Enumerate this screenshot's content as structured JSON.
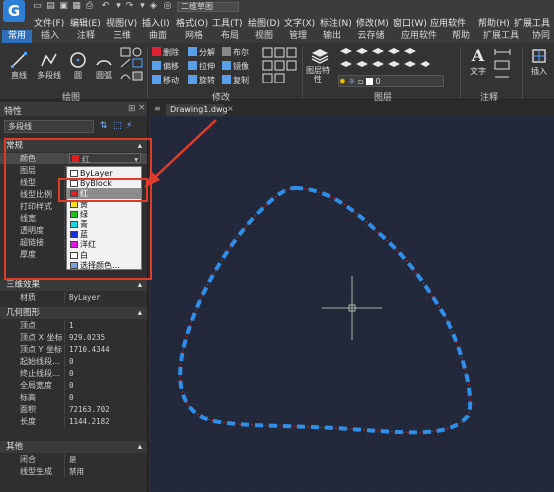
{
  "app": {
    "logo": "G",
    "document_title": "二维草图"
  },
  "menu": [
    "文件(F)",
    "编辑(E)",
    "视图(V)",
    "插入(I)",
    "格式(O)",
    "工具(T)",
    "绘图(D)",
    "文字(X)",
    "标注(N)",
    "修改(M)",
    "窗口(W)",
    "应用软件",
    "帮助(H)",
    "扩展工具"
  ],
  "ribbon_tabs": [
    "常用",
    "插入",
    "注释",
    "三维",
    "曲面",
    "网格",
    "布局",
    "视图",
    "管理",
    "输出",
    "云存储",
    "应用软件",
    "帮助",
    "扩展工具",
    "协同"
  ],
  "ribbon": {
    "draw_tools": [
      "直线",
      "多段线",
      "圆",
      "圆弧"
    ],
    "modify_tools": [
      "删除",
      "分解",
      "布尔",
      "偏移",
      "拉伸",
      "镜像",
      "移动",
      "旋转",
      "复制"
    ],
    "layer_tool": "图层特性",
    "layer_value": "0",
    "text_tool": "文字",
    "insert_tool": "插入",
    "group_draw": "绘图",
    "group_modify": "修改",
    "group_layer": "图层",
    "group_annot": "注释"
  },
  "properties": {
    "title": "特性",
    "object_type": "多段线",
    "general": {
      "section": "常规",
      "rows": [
        {
          "k": "颜色",
          "v": "红"
        },
        {
          "k": "图层",
          "v": ""
        },
        {
          "k": "线型",
          "v": ""
        },
        {
          "k": "线型比例",
          "v": ""
        },
        {
          "k": "打印样式",
          "v": ""
        },
        {
          "k": "线宽",
          "v": ""
        },
        {
          "k": "透明度",
          "v": ""
        },
        {
          "k": "超链接",
          "v": ""
        },
        {
          "k": "厚度",
          "v": ""
        }
      ]
    },
    "three_d": {
      "section": "三维效果",
      "rows": [
        {
          "k": "材质",
          "v": "ByLayer"
        }
      ]
    },
    "geometry": {
      "section": "几何图形",
      "rows": [
        {
          "k": "顶点",
          "v": "1"
        },
        {
          "k": "顶点 X 坐标",
          "v": "929.0235"
        },
        {
          "k": "顶点 Y 坐标",
          "v": "1710.4344"
        },
        {
          "k": "起始线段…",
          "v": "0"
        },
        {
          "k": "终止线段…",
          "v": "0"
        },
        {
          "k": "全局宽度",
          "v": "0"
        },
        {
          "k": "标高",
          "v": "0"
        },
        {
          "k": "面积",
          "v": "72163.702"
        },
        {
          "k": "长度",
          "v": "1144.2182"
        }
      ]
    },
    "other": {
      "section": "其他",
      "rows": [
        {
          "k": "闭合",
          "v": "是"
        },
        {
          "k": "线型生成",
          "v": "禁用"
        }
      ]
    }
  },
  "color_dropdown": [
    {
      "label": "ByLayer",
      "color": "#ffffff"
    },
    {
      "label": "ByBlock",
      "color": "#ffffff"
    },
    {
      "label": "红",
      "color": "#e02020"
    },
    {
      "label": "黄",
      "color": "#f2e21a"
    },
    {
      "label": "绿",
      "color": "#22c022"
    },
    {
      "label": "青",
      "color": "#1ad8e0"
    },
    {
      "label": "蓝",
      "color": "#1a2fe0"
    },
    {
      "label": "洋红",
      "color": "#e01ae0"
    },
    {
      "label": "白",
      "color": "#ffffff"
    },
    {
      "label": "选择颜色…",
      "color": "#7a9ed8"
    }
  ],
  "selected_color": "红",
  "drawing_tab": "Drawing1.dwg",
  "colors": {
    "accent": "#2f6fb9",
    "annotation": "#e03a2a",
    "polyline_dash": "#2f8fe8",
    "polyline_thin": "#d03030",
    "canvas_bg": "#22283a"
  }
}
